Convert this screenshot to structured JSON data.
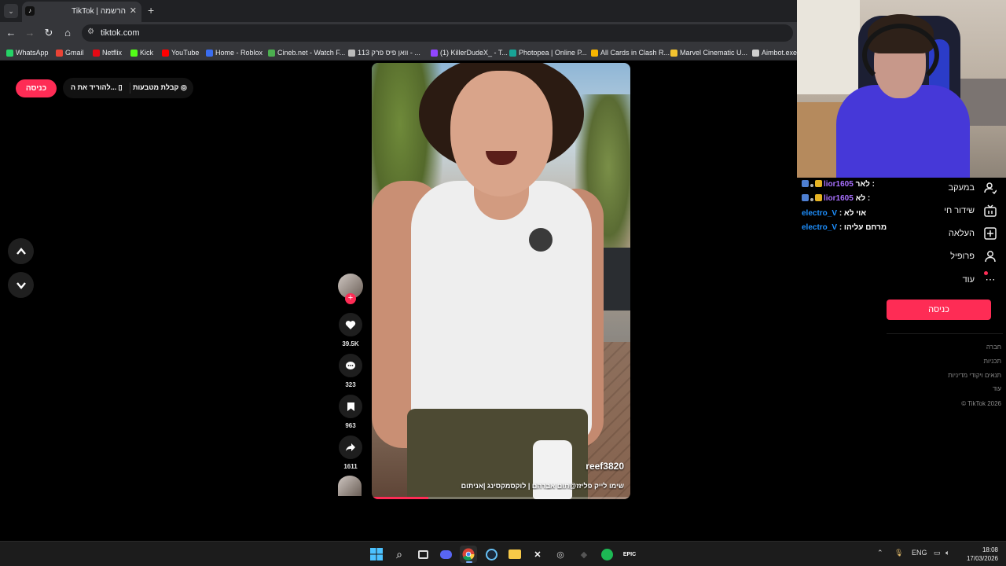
{
  "browser": {
    "tab_title": "TikTok | הרשמה",
    "url": "tiktok.com",
    "bookmarks": [
      {
        "label": "WhatsApp",
        "icon": "whatsapp-icon",
        "color": "#25d366"
      },
      {
        "label": "Gmail",
        "icon": "gmail-icon",
        "color": "#ea4335"
      },
      {
        "label": "Netflix",
        "icon": "netflix-icon",
        "color": "#e50914"
      },
      {
        "label": "Kick",
        "icon": "kick-icon",
        "color": "#53fc18"
      },
      {
        "label": "YouTube",
        "icon": "youtube-icon",
        "color": "#ff0000"
      },
      {
        "label": "Home - Roblox",
        "icon": "roblox-icon",
        "color": "#3a6df0"
      },
      {
        "label": "Cineb.net - Watch F...",
        "icon": "cineb-icon",
        "color": "#4caf50"
      },
      {
        "label": "וואן פיס פרק 113 - ...",
        "icon": "globe-icon",
        "color": "#bbbbbb"
      },
      {
        "label": "(1) KillerDudeX_ - T...",
        "icon": "twitch-icon",
        "color": "#9146ff"
      },
      {
        "label": "Photopea | Online P...",
        "icon": "photopea-icon",
        "color": "#18a497"
      },
      {
        "label": "All Cards in Clash R...",
        "icon": "clash-icon",
        "color": "#f7b500"
      },
      {
        "label": "Marvel Cinematic U...",
        "icon": "marvel-icon",
        "color": "#f4c430"
      },
      {
        "label": "Aimbot.exe",
        "icon": "aimbot-icon",
        "color": "#cfcfcf"
      }
    ]
  },
  "tiktok": {
    "login_label": "כניסה",
    "get_coins_label": "קבלת מטבעות",
    "download_label": "להוריד את ה...",
    "video": {
      "author": "reef3820",
      "caption": "שימו לייק פליזז@תום אברהם | לוקסמקסינג |אניתום",
      "progress": 0.22
    },
    "actions": {
      "likes": "39.5K",
      "comments": "323",
      "saves": "963",
      "shares": "1611"
    },
    "sidenav": [
      {
        "label": "במעקב",
        "icon": "following-icon"
      },
      {
        "label": "שידור חי",
        "icon": "live-icon"
      },
      {
        "label": "העלאה",
        "icon": "upload-icon"
      },
      {
        "label": "פרופיל",
        "icon": "profile-icon"
      },
      {
        "label": "עוד",
        "icon": "more-icon"
      }
    ],
    "side_login_label": "כניסה",
    "footer": [
      "חברה",
      "תכניות",
      "תנאים ויקודי מדיניות",
      "עוד",
      "© TikTok 2026"
    ]
  },
  "chat": [
    {
      "user": "lior1605",
      "message": "לאר :",
      "user_color": "#a970ff",
      "badges": true
    },
    {
      "user": "lior1605",
      "message": "לא :",
      "user_color": "#a970ff",
      "badges": true
    },
    {
      "user": "electro_V",
      "message": ": אוי לא",
      "user_color": "#1e90ff",
      "badges": false
    },
    {
      "user": "electro_V",
      "message": ": מרחם עליהו",
      "user_color": "#1e90ff",
      "badges": false
    }
  ],
  "taskbar": {
    "language": "ENG",
    "time": "18:08",
    "date": "17/03/2026"
  },
  "colors": {
    "accent": "#fe2c55",
    "chrome_dark": "#202124",
    "chrome": "#35363a"
  }
}
